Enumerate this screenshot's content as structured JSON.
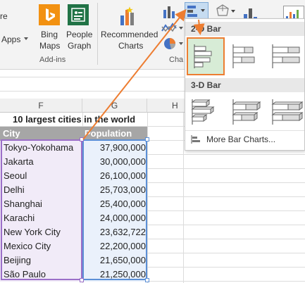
{
  "ribbon": {
    "partial_label": "re",
    "apps_label": "Apps",
    "bing_maps_line1": "Bing",
    "bing_maps_line2": "Maps",
    "people_graph_line1": "People",
    "people_graph_line2": "Graph",
    "recommended_line1": "Recommended",
    "recommended_line2": "Charts",
    "addins_group": "Add-ins",
    "charts_group_partial": "Cha"
  },
  "dropdown": {
    "section_2d": "2-D Bar",
    "section_3d": "3-D Bar",
    "more": "More Bar Charts..."
  },
  "sheet": {
    "col_headers": [
      "F",
      "G",
      "H"
    ],
    "title": "10 largest cities in the world",
    "header": {
      "city": "City",
      "population": "Population"
    },
    "rows": [
      {
        "city": "Tokyo-Yokohama",
        "population": "37,900,000"
      },
      {
        "city": "Jakarta",
        "population": "30,000,000"
      },
      {
        "city": "Seoul",
        "population": "26,100,000"
      },
      {
        "city": "Delhi",
        "population": "25,703,000"
      },
      {
        "city": "Shanghai",
        "population": "25,400,000"
      },
      {
        "city": "Karachi",
        "population": "24,000,000"
      },
      {
        "city": "New York City",
        "population": "23,632,722"
      },
      {
        "city": "Mexico City",
        "population": "22,200,000"
      },
      {
        "city": "Beijing",
        "population": "21,650,000"
      },
      {
        "city": "São Paulo",
        "population": "21,250,000"
      }
    ]
  },
  "colors": {
    "accent_orange": "#ed7d31",
    "header_fill": "#a6a6a6",
    "selection_purple": "#9b6fc8",
    "selection_blue": "#5b8fd6",
    "city_fill": "#f1ebf8",
    "pop_fill": "#eaf1fb"
  }
}
